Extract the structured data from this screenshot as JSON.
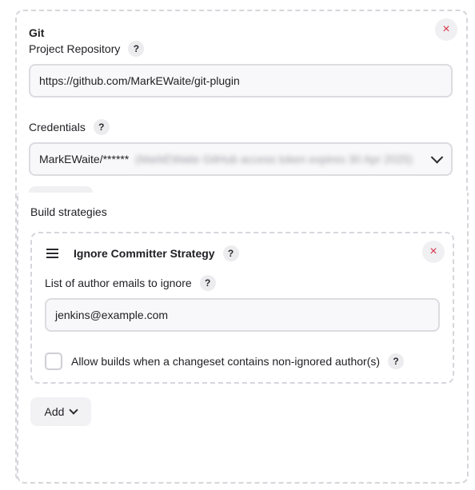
{
  "git": {
    "title": "Git",
    "close_icon": "×",
    "project_repository": {
      "label": "Project Repository",
      "help": "?",
      "value": "https://github.com/MarkEWaite/git-plugin"
    },
    "credentials": {
      "label": "Credentials",
      "help": "?",
      "selected": "MarkEWaite/******",
      "selected_detail": "(MarkEWaite GitHub access token expires 30 Apr 2025)"
    }
  },
  "build_strategies": {
    "label": "Build strategies",
    "strategy": {
      "title": "Ignore Committer Strategy",
      "help": "?",
      "close_icon": "×",
      "emails_label": "List of author emails to ignore",
      "emails_help": "?",
      "emails_value": "jenkins@example.com",
      "allow_label": "Allow builds when a changeset contains non-ignored author(s)",
      "allow_help": "?"
    },
    "add_label": "Add"
  },
  "colors": {
    "accent_close": "#d6344a",
    "border_dashed": "#d6d6dc"
  },
  "icons": [
    "close-icon",
    "help-icon",
    "chevron-down-icon",
    "drag-handle-icon"
  ]
}
